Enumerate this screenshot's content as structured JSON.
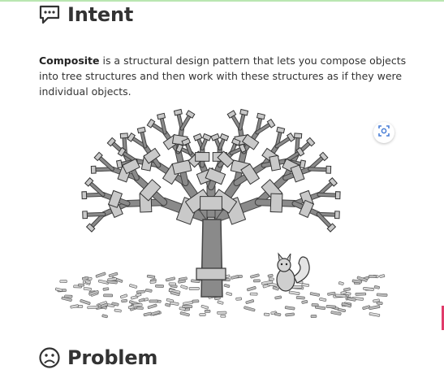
{
  "intent": {
    "title": "Intent",
    "icon": "speech-bubble-icon",
    "term": "Composite",
    "description": " is a structural design pattern that lets you compose objects into tree structures and then work with these structures as if they were individual objects."
  },
  "illustration": {
    "subject": "tree-with-squirrel-illustration",
    "zoom_icon": "zoom-screenshot-icon"
  },
  "problem": {
    "title": "Problem",
    "icon": "sad-face-icon"
  },
  "colors": {
    "heading_text": "#333333",
    "top_accent": "#b9e6b1",
    "side_marker": "#e03b6a",
    "zoom_icon": "#4a7fd6"
  }
}
